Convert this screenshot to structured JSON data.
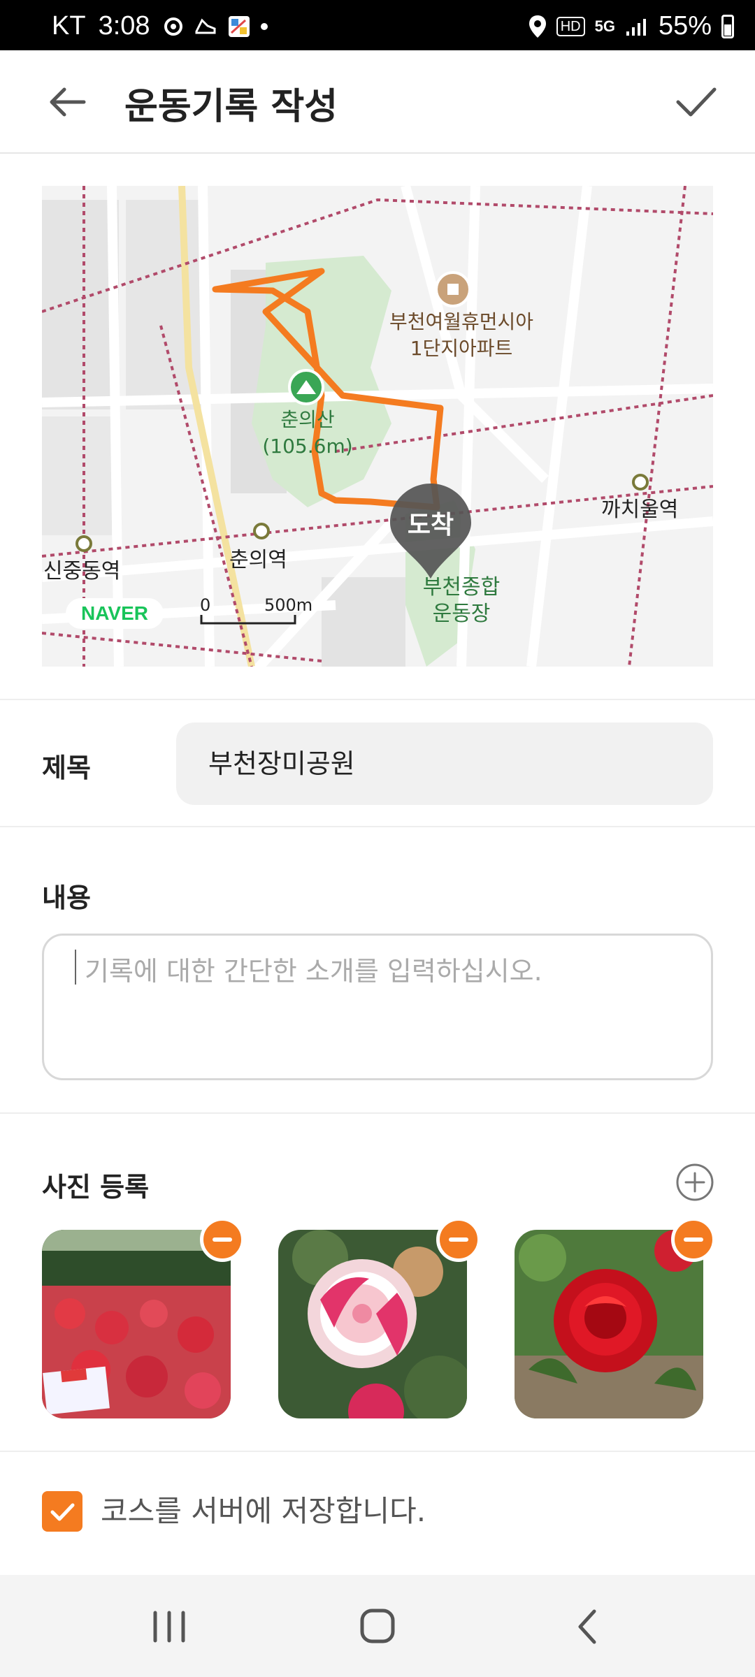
{
  "status_bar": {
    "carrier": "KT",
    "time": "3:08",
    "hd_label": "HD",
    "network": "5G",
    "battery": "55%"
  },
  "header": {
    "title": "운동기록 작성",
    "back_icon": "arrow-left-icon",
    "confirm_icon": "check-icon"
  },
  "map": {
    "places": {
      "apartment": "부천여월휴먼시아\n1단지아파트",
      "mountain": "춘의산\n(105.6m)",
      "station_east": "까치울역",
      "station_west": "신중동역",
      "station_center": "춘의역",
      "stadium": "부천종합\n운동장"
    },
    "marker": "도착",
    "logo": "NAVER",
    "scale_zero": "0",
    "scale_label": "500m",
    "route_color": "#f47b20"
  },
  "form": {
    "title_label": "제목",
    "title_value": "부천장미공원",
    "content_label": "내용",
    "content_placeholder": "기록에 대한 간단한 소개를 입력하십시오.",
    "photo_label": "사진 등록",
    "photos": [
      {
        "name": "rose-garden-photo"
      },
      {
        "name": "white-pink-rose-photo"
      },
      {
        "name": "red-rose-photo"
      }
    ],
    "save_course_label": "코스를 서버에 저장합니다.",
    "save_course_checked": true
  },
  "colors": {
    "accent": "#f47b20"
  }
}
